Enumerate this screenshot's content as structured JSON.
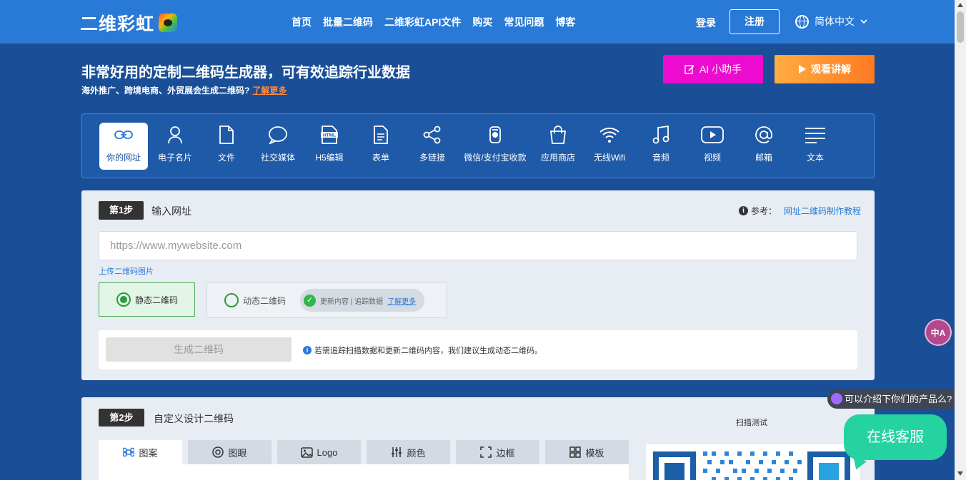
{
  "brand": {
    "name": "二维彩虹"
  },
  "nav": [
    "首页",
    "批量二维码",
    "二维彩虹API文件",
    "购买",
    "常见问题",
    "博客"
  ],
  "auth": {
    "login": "登录",
    "register": "注册"
  },
  "language": "简体中文",
  "hero": {
    "title": "非常好用的定制二维码生成器，可有效追踪行业数据",
    "subtitle": "海外推广、跨境电商、外贸展会生成二维码?",
    "learn_more": "了解更多",
    "ai_button": "AI 小助手",
    "watch_button": "观看讲解"
  },
  "types": [
    {
      "label": "你的网址",
      "icon": "link-icon"
    },
    {
      "label": "电子名片",
      "icon": "person-icon"
    },
    {
      "label": "文件",
      "icon": "file-icon"
    },
    {
      "label": "社交媒体",
      "icon": "chat-icon"
    },
    {
      "label": "H5编辑",
      "icon": "html-icon"
    },
    {
      "label": "表单",
      "icon": "form-icon"
    },
    {
      "label": "多链接",
      "icon": "share-icon"
    },
    {
      "label": "微信/支付宝收款",
      "icon": "payment-icon"
    },
    {
      "label": "应用商店",
      "icon": "bag-icon"
    },
    {
      "label": "无线Wifi",
      "icon": "wifi-icon"
    },
    {
      "label": "音频",
      "icon": "music-icon"
    },
    {
      "label": "视频",
      "icon": "video-icon"
    },
    {
      "label": "邮箱",
      "icon": "at-icon"
    },
    {
      "label": "文本",
      "icon": "text-icon"
    }
  ],
  "step1": {
    "badge": "第1步",
    "title": "输入网址",
    "ref_label": "参考：",
    "ref_link": "网址二维码制作教程",
    "url_placeholder": "https://www.mywebsite.com",
    "url_value": "",
    "upload": "上传二维码图片",
    "static": "静态二维码",
    "dynamic": "动态二维码",
    "dyn_tag": "更新内容 | 追踪数据",
    "dyn_more": "了解更多",
    "generate": "生成二维码",
    "tip": "若需追踪扫描数据和更新二维码内容，我们建议生成动态二维码。"
  },
  "step2": {
    "badge": "第2步",
    "title": "自定义设计二维码",
    "scan_test": "扫描测试",
    "tabs": [
      {
        "label": "图案",
        "icon": "command-icon"
      },
      {
        "label": "图眼",
        "icon": "eye-icon"
      },
      {
        "label": "Logo",
        "icon": "image-icon"
      },
      {
        "label": "颜色",
        "icon": "sliders-icon"
      },
      {
        "label": "边框",
        "icon": "frame-icon"
      },
      {
        "label": "模板",
        "icon": "grid-icon"
      }
    ]
  },
  "chat": {
    "prompt": "可以介绍下你们的产品么?",
    "service": "在线客服"
  },
  "translate": "中A",
  "colors": {
    "header": "#2979d6",
    "bg": "#1a4f97",
    "ai": "#ee0bd0",
    "watch": "#ff7a22",
    "service": "#25d3a0"
  }
}
